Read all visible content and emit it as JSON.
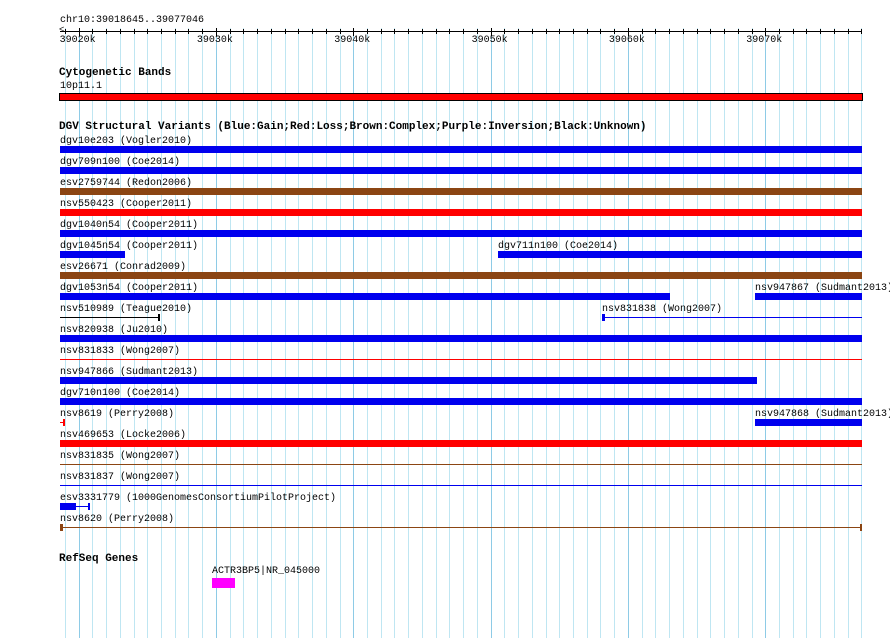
{
  "region": {
    "label": "chr10:39018645..39077046",
    "start": 39018645,
    "end": 39077046
  },
  "ruler": {
    "major_labels": [
      "39020k",
      "39030k",
      "39040k",
      "39050k",
      "39060k",
      "39070k"
    ],
    "major_positions": [
      39020000,
      39030000,
      39040000,
      39050000,
      39060000,
      39070000
    ]
  },
  "cyto": {
    "title": "Cytogenetic Bands",
    "band": {
      "name": "10p11.1",
      "start": 39018645,
      "end": 39077046,
      "color": "#ff0000"
    }
  },
  "dgv": {
    "title": "DGV Structural Variants (Blue:Gain;Red:Loss;Brown:Complex;Purple:Inversion;Black:Unknown)",
    "rows": [
      [
        {
          "name": "dgv10e203 (Vogler2010)",
          "start": 39018645,
          "end": 39077046,
          "color": "#0000ee",
          "style": "bar"
        }
      ],
      [
        {
          "name": "dgv709n100 (Coe2014)",
          "start": 39018645,
          "end": 39077046,
          "color": "#0000ee",
          "style": "bar"
        }
      ],
      [
        {
          "name": "esv2759744 (Redon2006)",
          "start": 39018645,
          "end": 39077046,
          "color": "#8b4513",
          "style": "bar"
        }
      ],
      [
        {
          "name": "nsv550423 (Cooper2011)",
          "start": 39018645,
          "end": 39077046,
          "color": "#ff0000",
          "style": "bar"
        }
      ],
      [
        {
          "name": "dgv1040n54 (Cooper2011)",
          "start": 39018645,
          "end": 39077046,
          "color": "#0000ee",
          "style": "bar"
        }
      ],
      [
        {
          "name": "dgv1045n54 (Cooper2011)",
          "start": 39018645,
          "end": 39023378,
          "color": "#0000ee",
          "style": "bar"
        },
        {
          "name": "dgv711n100 (Coe2014)",
          "start": 39050540,
          "end": 39077046,
          "color": "#0000ee",
          "style": "bar"
        }
      ],
      [
        {
          "name": "esv26671 (Conrad2009)",
          "start": 39018645,
          "end": 39077046,
          "color": "#8b4513",
          "style": "bar"
        }
      ],
      [
        {
          "name": "dgv1053n54 (Cooper2011)",
          "start": 39018645,
          "end": 39063065,
          "color": "#0000ee",
          "style": "bar"
        },
        {
          "name": "nsv947867 (Sudmant2013)",
          "start": 39069255,
          "end": 39077046,
          "color": "#0000ee",
          "style": "bar"
        }
      ],
      [
        {
          "name": "nsv510989 (Teague2010)",
          "start": 39018645,
          "end": 39025927,
          "color": "#000000",
          "style": "line-end"
        },
        {
          "name": "nsv831838 (Wong2007)",
          "start": 39058113,
          "end": 39077046,
          "color": "#0000ee",
          "style": "line-start"
        }
      ],
      [
        {
          "name": "nsv820938 (Ju2010)",
          "start": 39018645,
          "end": 39077046,
          "color": "#0000ee",
          "style": "bar"
        }
      ],
      [
        {
          "name": "nsv831833 (Wong2007)",
          "start": 39018645,
          "end": 39077046,
          "color": "#ff0000",
          "style": "line"
        }
      ],
      [
        {
          "name": "nsv947866 (Sudmant2013)",
          "start": 39018645,
          "end": 39069401,
          "color": "#0000ee",
          "style": "bar"
        }
      ],
      [
        {
          "name": "dgv710n100 (Coe2014)",
          "start": 39018645,
          "end": 39077046,
          "color": "#0000ee",
          "style": "bar"
        }
      ],
      [
        {
          "name": "nsv8619 (Perry2008)",
          "start": 39018645,
          "end": 39019009,
          "color": "#ff0000",
          "style": "line-end"
        },
        {
          "name": "nsv947868 (Sudmant2013)",
          "start": 39069255,
          "end": 39077046,
          "color": "#0000ee",
          "style": "bar"
        }
      ],
      [
        {
          "name": "nsv469653 (Locke2006)",
          "start": 39018645,
          "end": 39077046,
          "color": "#ff0000",
          "style": "bar"
        }
      ],
      [
        {
          "name": "nsv831835 (Wong2007)",
          "start": 39018645,
          "end": 39077046,
          "color": "#8b4513",
          "style": "line"
        }
      ],
      [
        {
          "name": "nsv831837 (Wong2007)",
          "start": 39018645,
          "end": 39077046,
          "color": "#0000ee",
          "style": "line"
        }
      ],
      [
        {
          "name": "esv3331779 (1000GenomesConsortiumPilotProject)",
          "start": 39018645,
          "end": 39020830,
          "thick_end": 39019810,
          "color": "#0000ee",
          "style": "partial"
        }
      ],
      [
        {
          "name": "nsv8620 (Perry2008)",
          "start": 39018645,
          "end": 39077046,
          "color": "#8b4513",
          "style": "line-both"
        }
      ]
    ]
  },
  "refseq": {
    "title": "RefSeq Genes",
    "genes": [
      {
        "name": "ACTR3BP5|NR_045000",
        "start": 39029714,
        "end": 39031389,
        "color": "#ff00ff"
      }
    ]
  }
}
